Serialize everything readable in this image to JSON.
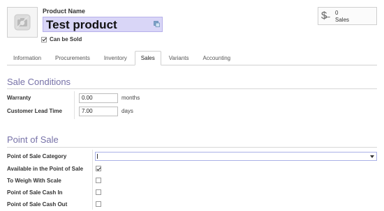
{
  "product": {
    "name_label": "Product Name",
    "name_value": "Test product",
    "can_be_sold_label": "Can be Sold",
    "can_be_sold_checked": true
  },
  "smart_button": {
    "count": "0",
    "label": "Sales",
    "icon": "strikethrough-dollar-icon"
  },
  "tabs": [
    {
      "label": "Information",
      "active": false
    },
    {
      "label": "Procurements",
      "active": false
    },
    {
      "label": "Inventory",
      "active": false
    },
    {
      "label": "Sales",
      "active": true
    },
    {
      "label": "Variants",
      "active": false
    },
    {
      "label": "Accounting",
      "active": false
    }
  ],
  "sale_conditions": {
    "title": "Sale Conditions",
    "warranty_label": "Warranty",
    "warranty_value": "0.00",
    "warranty_unit": "months",
    "lead_time_label": "Customer Lead Time",
    "lead_time_value": "7.00",
    "lead_time_unit": "days"
  },
  "point_of_sale": {
    "title": "Point of Sale",
    "category_label": "Point of Sale Category",
    "category_value": "",
    "available_label": "Available in the Point of Sale",
    "available_checked": true,
    "weigh_label": "To Weigh With Scale",
    "weigh_checked": false,
    "cash_in_label": "Point of Sale Cash In",
    "cash_in_checked": false,
    "cash_out_label": "Point of Sale Cash Out",
    "cash_out_checked": false
  },
  "colors": {
    "accent": "#7772a8",
    "name_field_bg": "#d9d6f7"
  }
}
